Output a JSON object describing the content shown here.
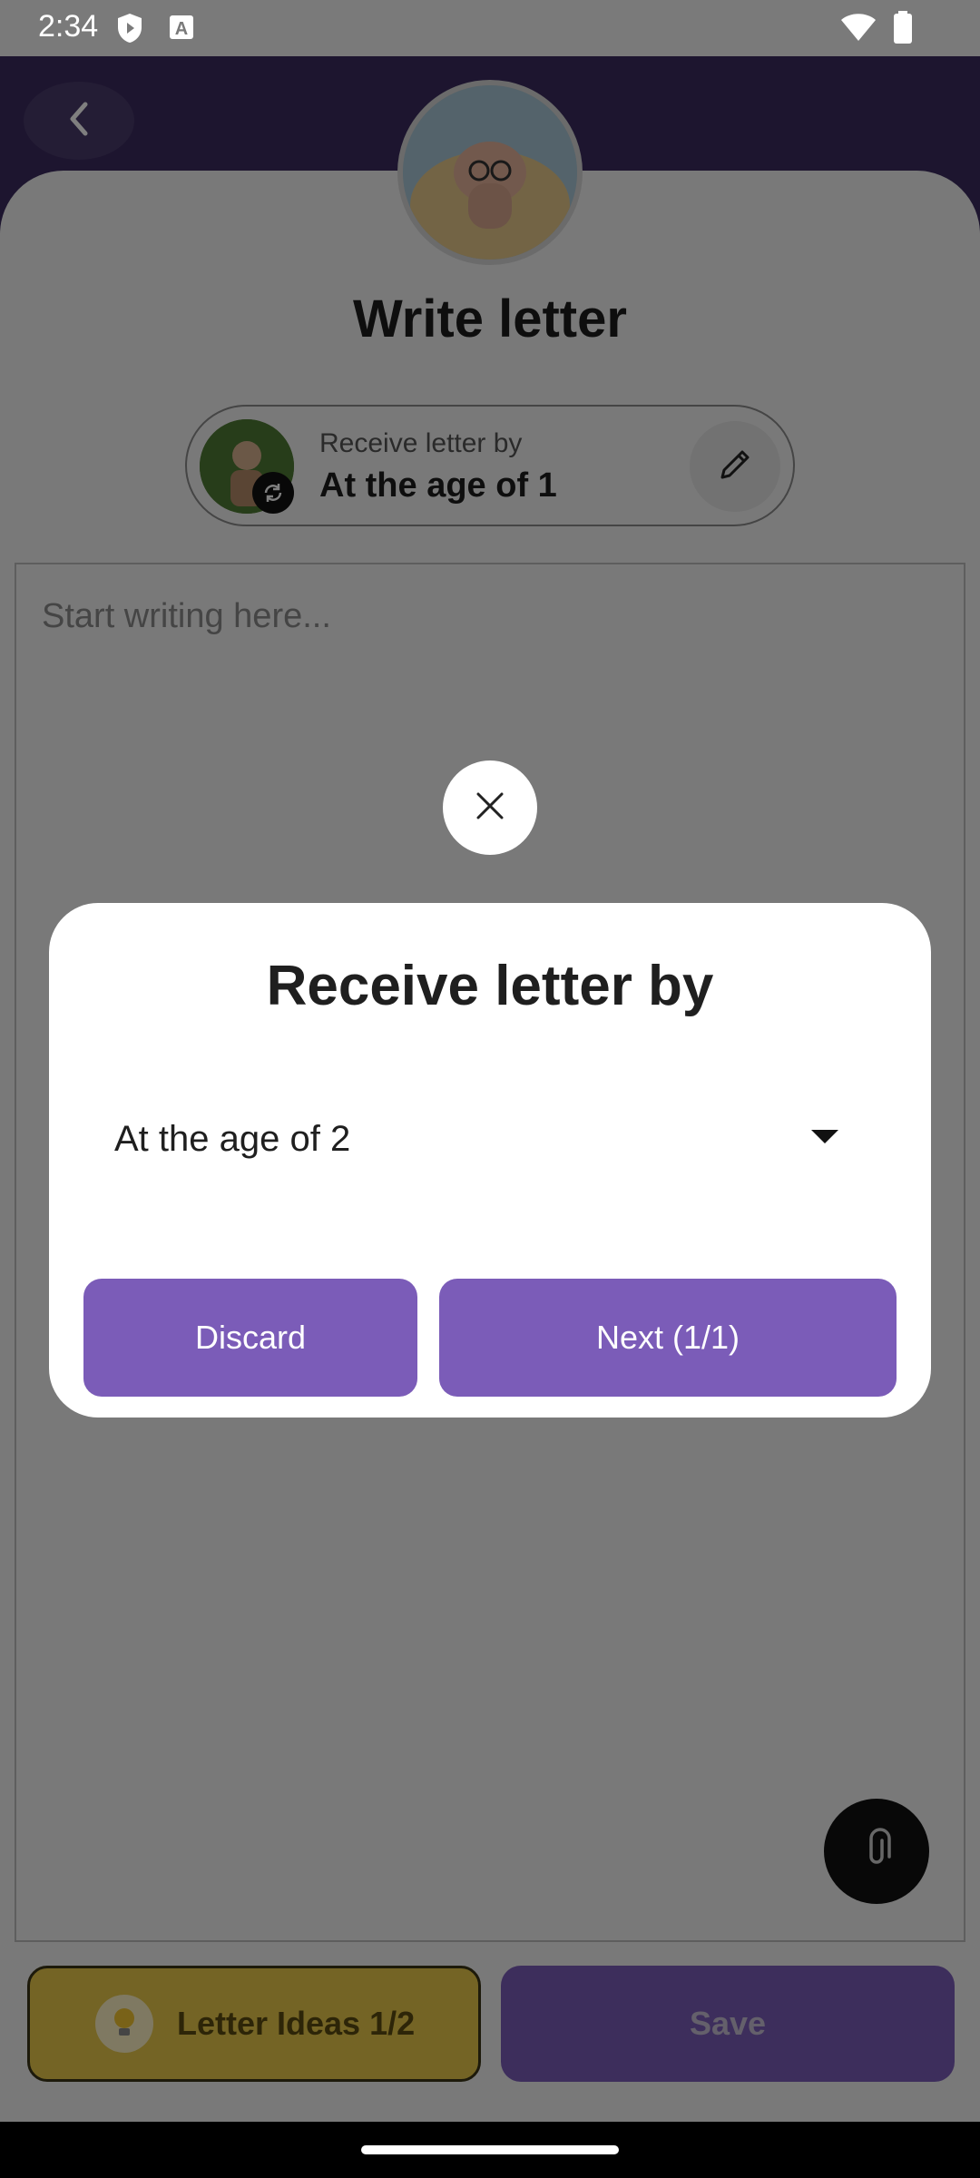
{
  "status_bar": {
    "time": "2:34",
    "icons": [
      "shield-icon",
      "keyboard-a-icon",
      "wifi-icon",
      "battery-icon"
    ]
  },
  "header": {
    "back_icon": "chevron-left-icon",
    "title": "Write letter"
  },
  "receive_pill": {
    "label": "Receive letter by",
    "value": "At the age of 1",
    "edit_icon": "pencil-icon",
    "swap_icon": "sync-icon"
  },
  "editor": {
    "placeholder": "Start writing here..."
  },
  "footer": {
    "ideas_label": "Letter Ideas 1/2",
    "save_label": "Save",
    "attach_icon": "paperclip-icon"
  },
  "dialog": {
    "title": "Receive letter by",
    "selected_option": "At the age of 2",
    "discard_label": "Discard",
    "next_label": "Next (1/1)",
    "close_icon": "close-icon"
  },
  "colors": {
    "accent_purple": "#7b5cb8",
    "header_purple": "#5b3f8f",
    "ideas_yellow": "#e8c94a"
  }
}
